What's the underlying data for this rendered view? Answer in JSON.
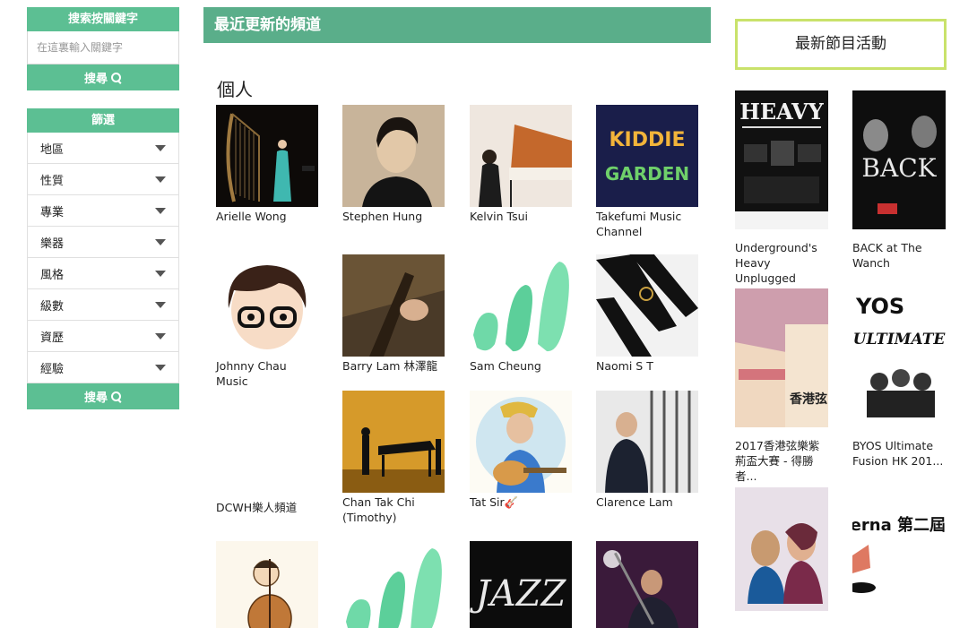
{
  "search": {
    "title": "搜索按關鍵字",
    "placeholder": "在這裏輸入關鍵字",
    "button_label": "搜尋"
  },
  "filter": {
    "title": "篩選",
    "items": [
      "地區",
      "性質",
      "專業",
      "樂器",
      "風格",
      "級數",
      "資歷",
      "經驗"
    ],
    "button_label": "搜尋"
  },
  "main": {
    "header": "最近更新的頻道",
    "section_title": "個人",
    "channels": [
      {
        "name": "Arielle Wong"
      },
      {
        "name": "Stephen Hung"
      },
      {
        "name": "Kelvin Tsui"
      },
      {
        "name": "Takefumi Music Channel"
      },
      {
        "name": "Johnny Chau Music"
      },
      {
        "name": "Barry Lam 林澤龍"
      },
      {
        "name": "Sam Cheung"
      },
      {
        "name": "Naomi S T"
      },
      {
        "name": "DCWH樂人頻道"
      },
      {
        "name": "Chan Tak Chi (Timothy)"
      },
      {
        "name": "Tat Sir🎸"
      },
      {
        "name": "Clarence Lam"
      },
      {
        "name": ""
      },
      {
        "name": ""
      },
      {
        "name": ""
      },
      {
        "name": ""
      }
    ]
  },
  "events": {
    "header": "最新節目活動",
    "items": [
      {
        "name": "Underground's Heavy Unplugged",
        "poster_text": "HEAVY"
      },
      {
        "name": "BACK at The Wanch",
        "poster_text": "BACK"
      },
      {
        "name": "2017香港弦樂紫荊盃大賽 - 得勝者...",
        "poster_text": "香港弦"
      },
      {
        "name": "BYOS Ultimate Fusion HK 201...",
        "poster_text": "ULTIMATE"
      },
      {
        "name": "",
        "poster_text": ""
      },
      {
        "name": "",
        "poster_text": "The Interna 第二屆"
      }
    ]
  },
  "colors": {
    "accent": "#5cbf93",
    "header": "#5aae8a",
    "event_border": "#c9e26b"
  }
}
